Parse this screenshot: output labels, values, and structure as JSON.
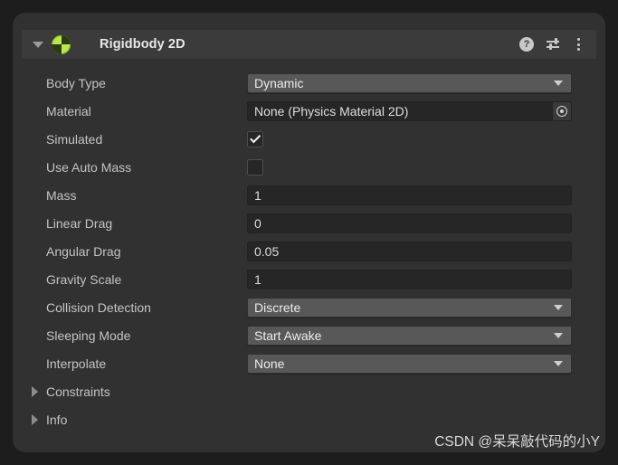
{
  "component": {
    "title": "Rigidbody 2D",
    "icon": "rigidbody2d-icon",
    "expanded": true,
    "accent_green": "#b5e853",
    "header_icons": {
      "help": "?",
      "help_name": "help-icon",
      "settings_name": "preset-settings-icon",
      "menu_name": "more-options-icon"
    }
  },
  "properties": [
    {
      "label": "Body Type",
      "type": "popup",
      "value": "Dynamic"
    },
    {
      "label": "Material",
      "type": "object",
      "value": "None (Physics Material 2D)"
    },
    {
      "label": "Simulated",
      "type": "checkbox",
      "value": true
    },
    {
      "label": "Use Auto Mass",
      "type": "checkbox",
      "value": false
    },
    {
      "label": "Mass",
      "type": "number",
      "value": "1"
    },
    {
      "label": "Linear Drag",
      "type": "number",
      "value": "0"
    },
    {
      "label": "Angular Drag",
      "type": "number",
      "value": "0.05"
    },
    {
      "label": "Gravity Scale",
      "type": "number",
      "value": "1"
    },
    {
      "label": "Collision Detection",
      "type": "popup",
      "value": "Discrete"
    },
    {
      "label": "Sleeping Mode",
      "type": "popup",
      "value": "Start Awake"
    },
    {
      "label": "Interpolate",
      "type": "popup",
      "value": "None"
    },
    {
      "label": "Constraints",
      "type": "foldout",
      "value": ""
    },
    {
      "label": "Info",
      "type": "foldout",
      "value": ""
    }
  ],
  "watermark": {
    "text": "CSDN @呆呆敲代码的小Y"
  }
}
